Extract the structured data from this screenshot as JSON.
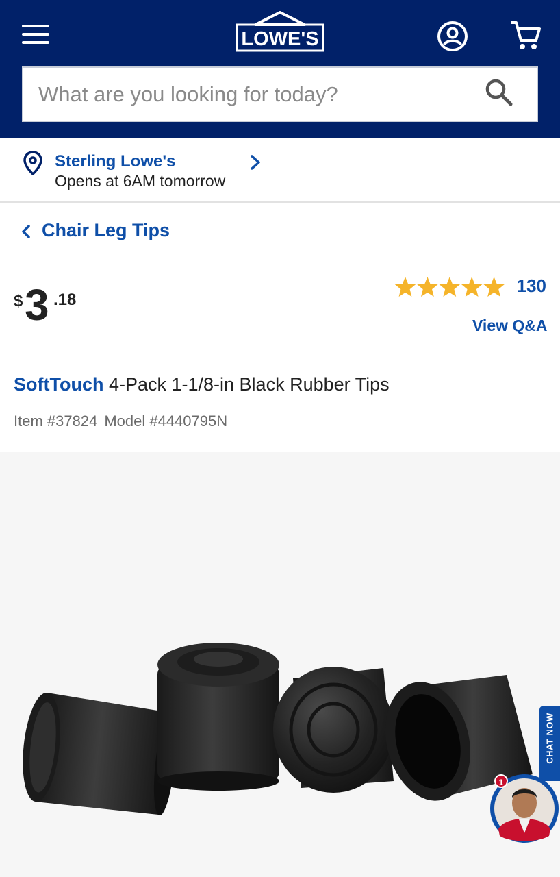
{
  "header": {
    "logo_text": "LOWE'S",
    "icons": {
      "menu": "hamburger-icon",
      "account": "account-icon",
      "cart": "cart-icon",
      "search": "search-icon"
    },
    "background": "#012169"
  },
  "search": {
    "placeholder": "What are you looking for today?",
    "value": ""
  },
  "store": {
    "name": "Sterling Lowe's",
    "hours": "Opens at 6AM tomorrow"
  },
  "breadcrumb": {
    "label": "Chair Leg Tips"
  },
  "price": {
    "currency": "$",
    "whole": "3",
    "cents": ".18"
  },
  "rating": {
    "stars": 5,
    "count": "130",
    "view_qa": "View Q&A",
    "star_color": "#f5b42a"
  },
  "product": {
    "brand": "SoftTouch",
    "title": " 4-Pack 1-1/8-in Black Rubber Tips",
    "item": "Item #37824",
    "model": "Model #4440795N"
  },
  "chat": {
    "label": "CHAT NOW",
    "badge": "1"
  },
  "colors": {
    "link_blue": "#0f4fa8",
    "brand_navy": "#012169"
  }
}
